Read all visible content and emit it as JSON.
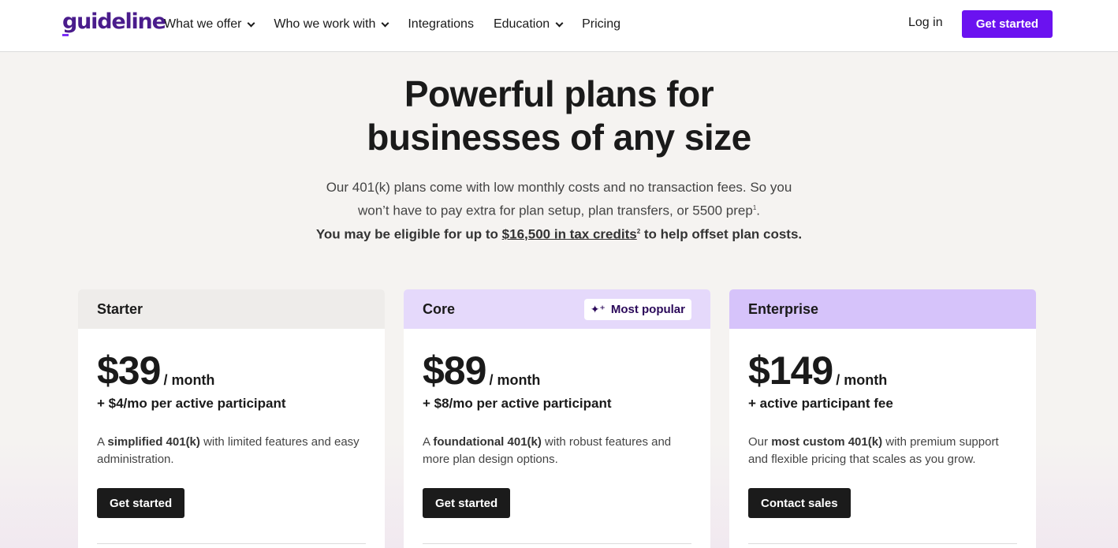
{
  "header": {
    "logo": "guideline",
    "nav": [
      {
        "label": "What we offer",
        "dropdown": true
      },
      {
        "label": "Who we work with",
        "dropdown": true
      },
      {
        "label": "Integrations",
        "dropdown": false
      },
      {
        "label": "Education",
        "dropdown": true
      },
      {
        "label": "Pricing",
        "dropdown": false
      }
    ],
    "login": "Log in",
    "cta": "Get started"
  },
  "hero": {
    "title_line1": "Powerful plans for",
    "title_line2": "businesses of any size",
    "sub_line1": "Our 401(k) plans come with low monthly costs and no transaction fees. So you",
    "sub_line2": "won’t have to pay extra for plan setup, plan transfers, or 5500 prep",
    "sub_line2_sup": "1",
    "sub_line2_end": ".",
    "eligible_prefix": "You may be eligible for up to ",
    "eligible_link": "$16,500 in tax credits",
    "eligible_sup": "2",
    "eligible_suffix": " to help offset plan costs."
  },
  "plans": [
    {
      "name": "Starter",
      "badge": "",
      "price": "$39",
      "period": "/ month",
      "fee": "+ $4/mo per active participant",
      "desc_prefix": "A ",
      "desc_bold": "simplified 401(k)",
      "desc_suffix": " with limited features and easy administration.",
      "button": "Get started",
      "header_color": "#eeecea"
    },
    {
      "name": "Core",
      "badge": "Most popular",
      "price": "$89",
      "period": "/ month",
      "fee": "+ $8/mo per active participant",
      "desc_prefix": "A ",
      "desc_bold": "foundational 401(k)",
      "desc_suffix": " with robust features and more plan design options.",
      "button": "Get started",
      "header_color": "#e5d9fb"
    },
    {
      "name": "Enterprise",
      "badge": "",
      "price": "$149",
      "period": "/ month",
      "fee": "+ active participant fee",
      "desc_prefix": "Our ",
      "desc_bold": "most custom 401(k)",
      "desc_suffix": " with premium support and flexible pricing that scales as you grow.",
      "button": "Contact sales",
      "header_color": "#d6c3fa"
    }
  ],
  "colors": {
    "brand": "#4a1c8c",
    "cta": "#6b12f0",
    "background": "#f5f3f1"
  }
}
